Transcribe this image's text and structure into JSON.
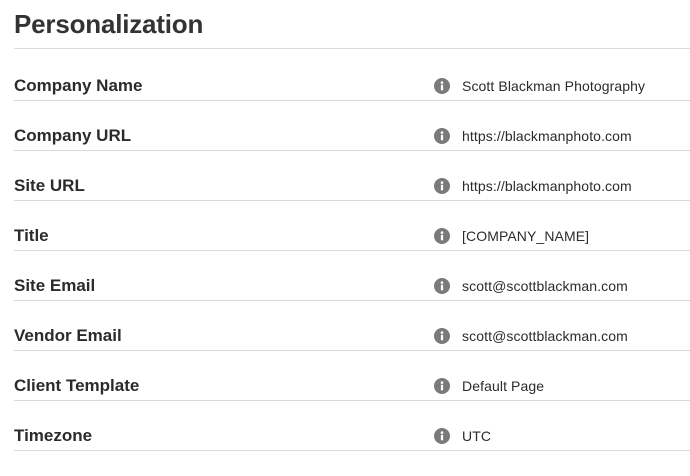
{
  "page": {
    "title": "Personalization"
  },
  "settings": [
    {
      "label": "Company Name",
      "value": "Scott Blackman Photography",
      "icon": "info-icon"
    },
    {
      "label": "Company URL",
      "value": "https://blackmanphoto.com",
      "icon": "info-icon"
    },
    {
      "label": "Site URL",
      "value": "https://blackmanphoto.com",
      "icon": "info-icon"
    },
    {
      "label": "Title",
      "value": "[COMPANY_NAME]",
      "icon": "info-icon"
    },
    {
      "label": "Site Email",
      "value": "scott@scottblackman.com",
      "icon": "info-icon"
    },
    {
      "label": "Vendor Email",
      "value": "scott@scottblackman.com",
      "icon": "info-icon"
    },
    {
      "label": "Client Template",
      "value": "Default Page",
      "icon": "info-icon"
    },
    {
      "label": "Timezone",
      "value": "UTC",
      "icon": "info-icon"
    }
  ],
  "colors": {
    "info_icon": "#7a7a7a",
    "divider": "#d9d9d9",
    "text": "#2b2b2b"
  }
}
